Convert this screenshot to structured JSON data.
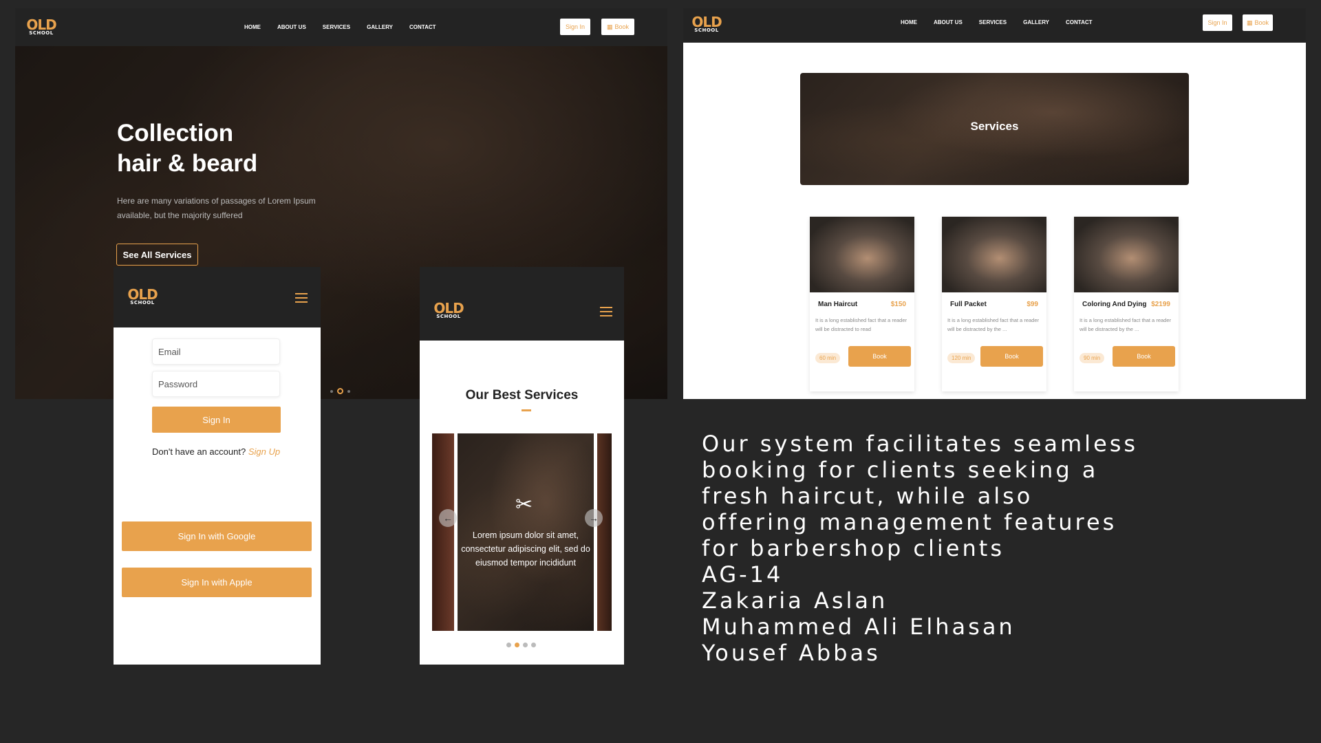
{
  "brand": {
    "logo_top": "OLD",
    "logo_bottom": "SCHOOL"
  },
  "nav": {
    "links": [
      "HOME",
      "ABOUT US",
      "SERVICES",
      "GALLERY",
      "CONTACT"
    ],
    "sign_in": "Sign In",
    "book": "Book"
  },
  "hero": {
    "title_line1": "Collection",
    "title_line2": "hair & beard",
    "subtitle_line1": "Here are many variations of passages of Lorem Ipsum",
    "subtitle_line2": "available, but the majority suffered",
    "cta": "See All Services"
  },
  "services_page": {
    "banner_title": "Services",
    "cards": [
      {
        "name": "Man Haircut",
        "price": "$150",
        "desc": "It is a long established fact that a reader will be distracted to read",
        "duration": "60 min",
        "button": "Book"
      },
      {
        "name": "Full Packet",
        "price": "$99",
        "desc": "It is a long established fact that a reader will be distracted by the ...",
        "duration": "120 min",
        "button": "Book"
      },
      {
        "name": "Coloring And Dying",
        "price": "$2199",
        "desc": "It is a long established fact that a reader will be distracted by the ...",
        "duration": "90 min",
        "button": "Book"
      }
    ]
  },
  "login": {
    "email_placeholder": "Email",
    "password_placeholder": "Password",
    "sign_in": "Sign In",
    "no_account": "Don't have an account?",
    "sign_up": "Sign Up",
    "google": "Sign In with Google",
    "apple": "Sign In with Apple"
  },
  "mobile_services": {
    "title": "Our Best Services",
    "slide_text_1": "Lorem ipsum dolor sit amet,",
    "slide_text_2": "consectetur adipiscing elit, sed do",
    "slide_text_3": "eiusmod tempor incididunt"
  },
  "caption": {
    "lines": [
      "Our system facilitates seamless",
      "booking for clients seeking a",
      "fresh haircut, while also",
      "offering management features",
      "for barbershop clients",
      "AG-14",
      "Zakaria Aslan",
      "Muhammed Ali Elhasan",
      "Yousef Abbas"
    ]
  },
  "colors": {
    "accent": "#e8a24d",
    "dark": "#232323",
    "background": "#262626"
  }
}
